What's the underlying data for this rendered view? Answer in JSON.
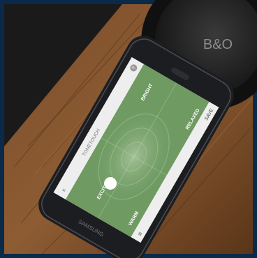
{
  "phone": {
    "brand": "SAMSUNG",
    "app_title": "TONETOUCH",
    "close_glyph": "×",
    "help_glyph": "?",
    "menu_glyph": "≡",
    "save_label": "SAVE",
    "icons": {
      "close": "close-icon",
      "help": "help-icon",
      "menu": "menu-icon",
      "puck": "tone-puck-icon"
    }
  },
  "tone_grid": {
    "labels": {
      "top": "EXCITED",
      "left": "WARM",
      "right": "BRIGHT",
      "bottom": "RELAXED"
    }
  },
  "headphones": {
    "logo": "B&O"
  },
  "colors": {
    "frame": "#0b2a4a",
    "wood": "#6e4526",
    "wood_light": "#9a6a3e",
    "screen_green": "#6f9a62",
    "phone_body": "#1b1d20"
  }
}
